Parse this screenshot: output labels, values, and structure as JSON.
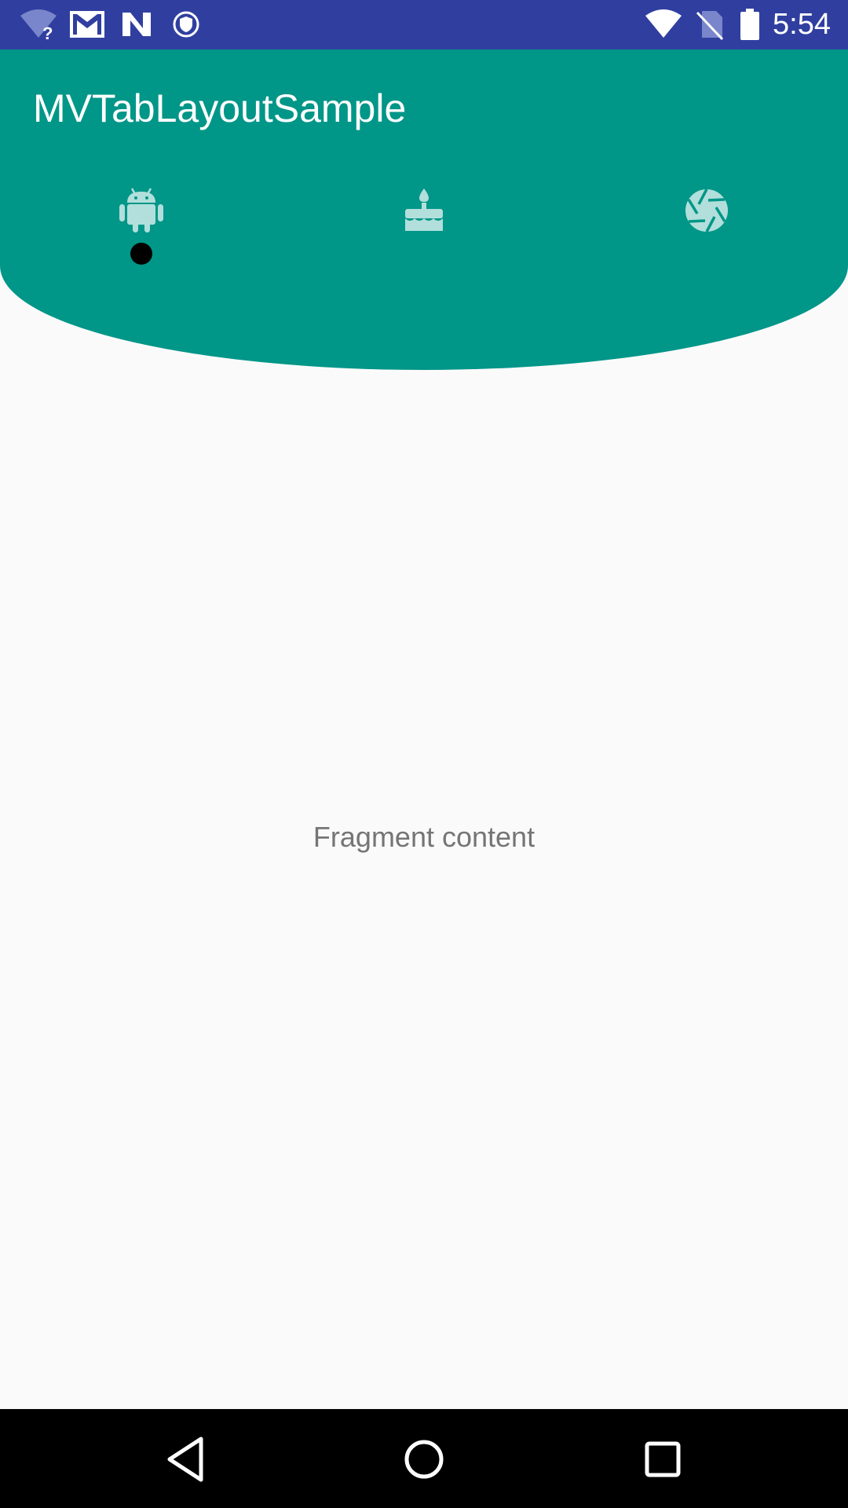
{
  "status_bar": {
    "time": "5:54",
    "background_color": "#303f9f",
    "left_icons": [
      "wifi-unknown-icon",
      "gmail-icon",
      "n-logo-icon",
      "shield-icon"
    ],
    "right_icons": [
      "wifi-icon",
      "no-signal-icon",
      "battery-icon"
    ]
  },
  "app_bar": {
    "title": "MVTabLayoutSample",
    "background_color": "#009688"
  },
  "tabs": [
    {
      "icon": "android-icon",
      "selected": true
    },
    {
      "icon": "cake-icon",
      "selected": false
    },
    {
      "icon": "camera-aperture-icon",
      "selected": false
    }
  ],
  "content": {
    "text": "Fragment content"
  },
  "nav_bar": {
    "buttons": [
      "back-icon",
      "home-icon",
      "recents-icon"
    ]
  }
}
